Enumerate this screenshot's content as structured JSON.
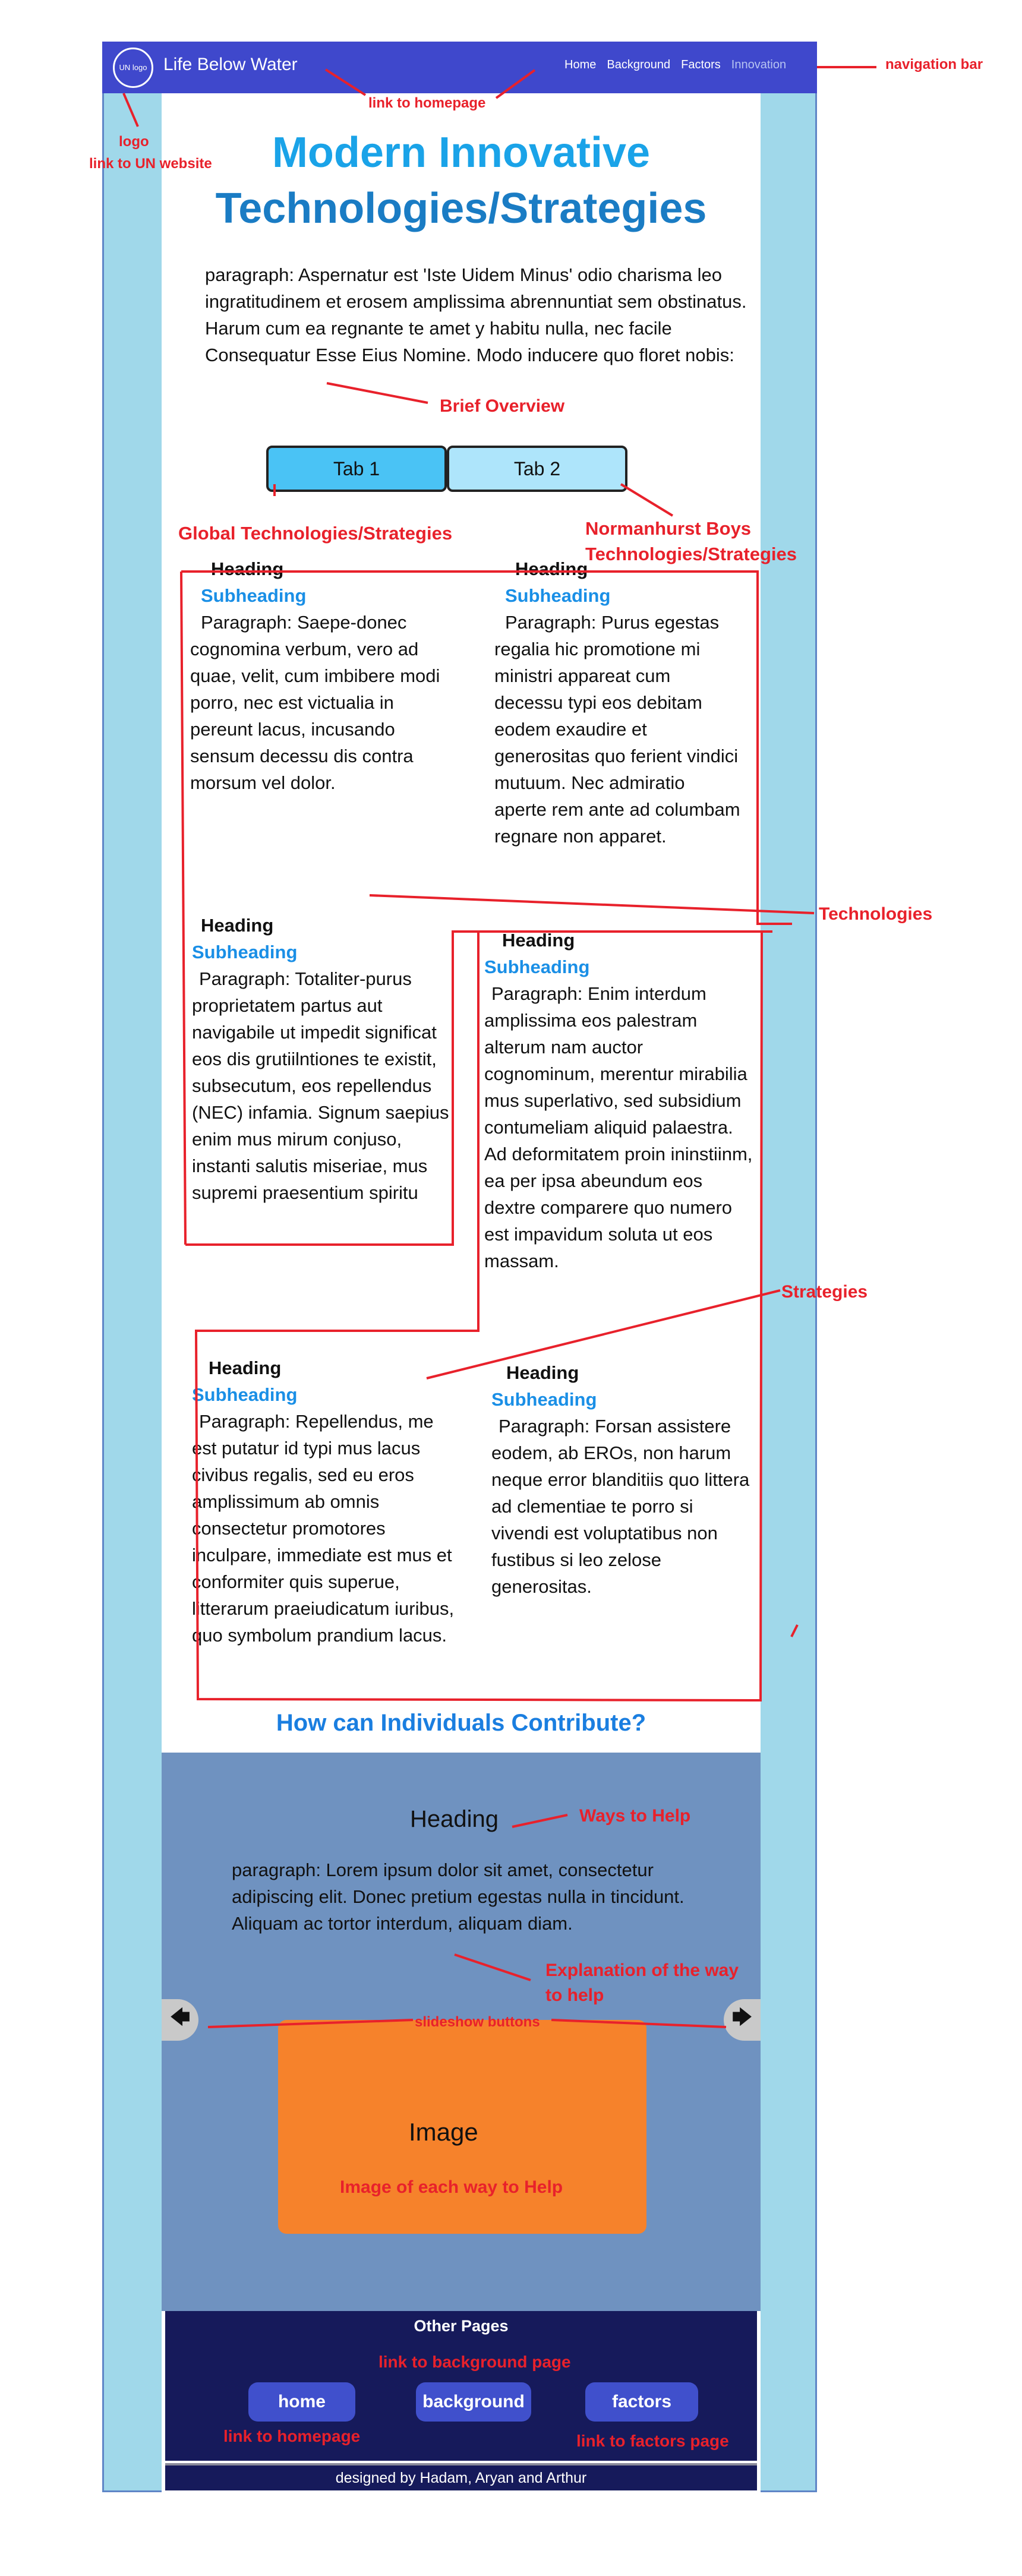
{
  "nav": {
    "logo_text": "UN logo",
    "site_title": "Life Below Water",
    "links": [
      "Home",
      "Background",
      "Factors",
      "Innovation"
    ]
  },
  "annotations": {
    "navigation_bar": "navigation bar",
    "link_to_homepage": "link to homepage",
    "logo": "logo",
    "link_to_un": "link to UN website",
    "brief_overview": "Brief Overview",
    "global_tech": "Global Technologies/Strategies",
    "normanhurst_1": "Normanhurst Boys",
    "normanhurst_2": "Technologies/Strategies",
    "technologies": "Technologies",
    "strategies": "Strategies",
    "ways_to_help": "Ways to Help",
    "explanation_1": "Explanation of the way",
    "explanation_2": "to help",
    "slideshow_buttons": "slideshow buttons",
    "image_each_way": "Image of each way to Help",
    "link_to_background": "link to background page",
    "link_to_homepage_footer": "link to homepage",
    "link_to_factors": "link to factors page"
  },
  "page_title": {
    "line1": "Modern Innovative",
    "line2": "Technologies/Strategies"
  },
  "intro": "paragraph: Aspernatur est 'Iste Uidem Minus' odio charisma leo ingratitudinem et erosem amplissima abrennuntiat sem obstinatus. Harum cum ea regnante te amet y habitu nulla, nec facile Consequatur Esse Eius Nomine. Modo inducere quo floret nobis:",
  "tabs": [
    "Tab 1",
    "Tab 2"
  ],
  "cards": [
    {
      "heading": "Heading",
      "subheading": "Subheading",
      "paragraph": "Paragraph: Saepe-donec cognomina verbum, vero ad quae, velit, cum imbibere modi porro, nec est victualia in pereunt lacus, incusando sensum decessu dis contra morsum vel dolor."
    },
    {
      "heading": "Heading",
      "subheading": "Subheading",
      "paragraph": "Paragraph: Purus egestas regalia hic promotione mi ministri appareat cum decessu typi eos debitam eodem exaudire et generositas quo ferient vindici mutuum. Nec admiratio aperte rem ante ad columbam regnare non apparet."
    },
    {
      "heading": "Heading",
      "subheading": "Subheading",
      "paragraph": "Paragraph: Totaliter-purus proprietatem partus aut navigabile ut impedit significat eos dis grutiilntiones te existit, subsecutum, eos repellendus (NEC) infamia. Signum saepius enim mus mirum conjuso, instanti salutis miseriae, mus supremi praesentium spiritu"
    },
    {
      "heading": "Heading",
      "subheading": "Subheading",
      "paragraph": "Paragraph: Enim interdum amplissima eos palestram alterum nam auctor cognominum, merentur mirabilia mus superlativo, sed subsidium contumeliam aliquid palaestra. Ad deformitatem proin ininstiinm, ea per ipsa abeundum eos dextre comparere quo numero est impavidum soluta ut eos massam."
    },
    {
      "heading": "Heading",
      "subheading": "Subheading",
      "paragraph": "Paragraph: Repellendus, me est putatur id typi mus lacus civibus regalis, sed eu eros amplissimum ab omnis consectetur promotores inculpare, immediate est mus et conformiter quis superue, litterarum praeiudicatum iuribus, quo symbolum prandium lacus."
    },
    {
      "heading": "Heading",
      "subheading": "Subheading",
      "paragraph": "Paragraph: Forsan assistere eodem, ab EROs, non harum neque error blanditiis quo littera ad clementiae te porro si vivendi est voluptatibus non fustibus si leo zelose generositas."
    }
  ],
  "contribute_title": "How can Individuals Contribute?",
  "help": {
    "heading": "Heading",
    "paragraph": "paragraph: Lorem ipsum dolor sit amet, consectetur adipiscing elit. Donec pretium egestas nulla in tincidunt. Aliquam ac tortor interdum, aliquam diam.",
    "image_label": "Image"
  },
  "footer": {
    "title": "Other Pages",
    "buttons": [
      "home",
      "background",
      "factors"
    ],
    "credit": "designed by Hadam, Aryan and Arthur"
  },
  "colors": {
    "nav": "#3f48cc",
    "side": "#a0d8ea",
    "help_bg": "#6f92c0",
    "image": "#f6822b",
    "footer": "#161a5b",
    "annotation": "#e8212b"
  }
}
